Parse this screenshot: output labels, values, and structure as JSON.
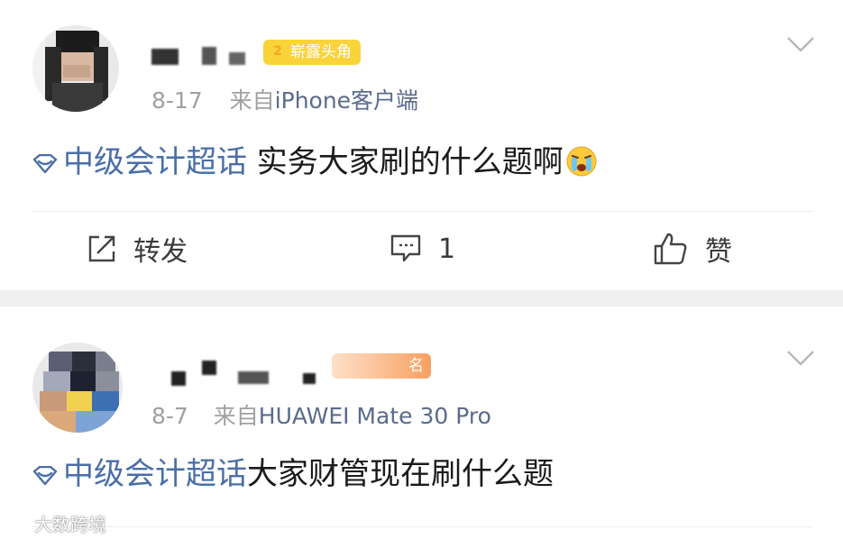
{
  "posts": [
    {
      "badge_num": "2",
      "badge_label": "崭露头角",
      "date": "8-17",
      "source_prefix": "来自",
      "source": "iPhone客户端",
      "topic": "中级会计超话",
      "text": " 实务大家刷的什么题啊",
      "emoji": "crying-face",
      "actions": {
        "repost": "转发",
        "comment_count": "1",
        "like": "赞"
      }
    },
    {
      "badge_label": "名",
      "date": "8-7",
      "source_prefix": "来自",
      "source": "HUAWEI Mate 30 Pro",
      "topic": "中级会计超话",
      "text": "大家财管现在刷什么题"
    }
  ],
  "watermark": "大数跨境",
  "colors": {
    "topic": "#4a6ea8",
    "badge": "#f9d33a",
    "meta": "#a0a0a0",
    "separator": "#f0f0f0"
  }
}
